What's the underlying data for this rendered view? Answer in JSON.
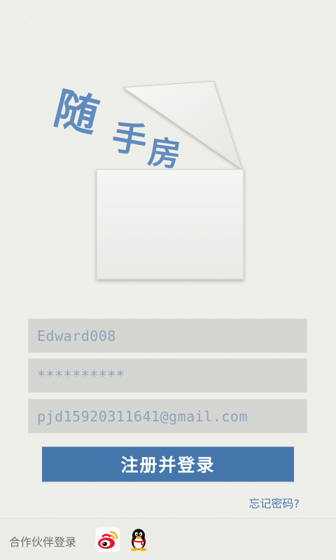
{
  "logo": {
    "chars": [
      "随",
      "手",
      "房"
    ],
    "color": "#5f8bbf"
  },
  "form": {
    "username": {
      "value": "Edward008",
      "placeholder": ""
    },
    "password": {
      "value": "**********",
      "placeholder": ""
    },
    "email": {
      "value": "pjd15920311641@gmail.com",
      "placeholder": ""
    },
    "submit_label": "注册并登录",
    "forgot_label": "忘记密码?"
  },
  "footer": {
    "label": "合作伙伴登录",
    "partners": [
      {
        "name": "weibo",
        "icon": "weibo-icon"
      },
      {
        "name": "qq",
        "icon": "qq-icon"
      }
    ]
  },
  "colors": {
    "background": "#f0f0ea",
    "accent": "#4677ac",
    "field": "#d6d6d2",
    "field_text": "#8ea3bd",
    "link": "#4e78a8"
  }
}
